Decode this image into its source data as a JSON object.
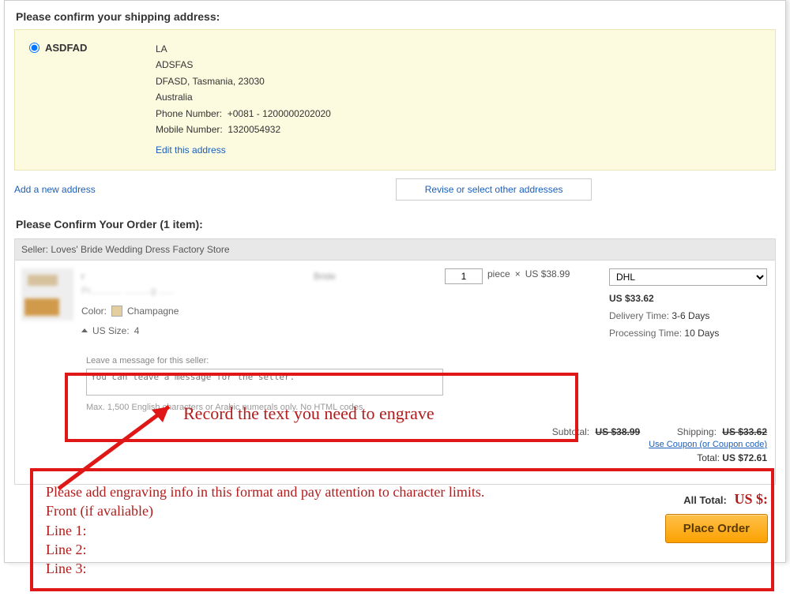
{
  "shipping": {
    "title": "Please confirm your shipping address:",
    "name": "ASDFAD",
    "line1": "LA",
    "line2": "ADSFAS",
    "line3": "DFASD, Tasmania, 23030",
    "country": "Australia",
    "phone_label": "Phone Number:",
    "phone": "+0081 - 1200000202020",
    "mobile_label": "Mobile Number:",
    "mobile": "1320054932",
    "edit": "Edit this address",
    "add_new": "Add a new address",
    "revise": "Revise or select other addresses"
  },
  "order": {
    "confirm_title": "Please Confirm Your Order (1 item):",
    "seller_label": "Seller:",
    "seller_name": "Loves' Bride Wedding Dress Factory Store",
    "item_tail": "Bride",
    "color_label": "Color:",
    "color_value": "Champagne",
    "size_label": "US Size:",
    "size_value": "4",
    "qty": "1",
    "piece_label": "piece",
    "times": "×",
    "unit_price": "US $38.99",
    "ship_method": "DHL",
    "ship_price": "US $33.62",
    "delivery_label": "Delivery Time:",
    "delivery_value": "3-6 Days",
    "processing_label": "Processing Time:",
    "processing_value": "10 Days",
    "msg_label": "Leave a message for this seller:",
    "msg_placeholder": "You can leave a message for the seller.",
    "msg_hint": "Max. 1,500 English characters or Arabic numerals only. No HTML codes.",
    "subtotal_label": "Subtotal:",
    "subtotal_value": "US $38.99",
    "shipping_label": "Shipping:",
    "shipping_value": "US $33.62",
    "coupon": "Use Coupon (or Coupon code)",
    "total_label": "Total:",
    "total_value": "US $72.61",
    "all_total_label": "All Total:",
    "all_total_value": "US $:",
    "place_order": "Place Order"
  },
  "annotations": {
    "record_text": "Record the text you need to engrave",
    "instruction_1": "Please add engraving info in this format and pay attention to character limits.",
    "instruction_2": "Front (if avaliable)",
    "instruction_3": "Line 1:",
    "instruction_4": "Line 2:",
    "instruction_5": "Line 3:"
  }
}
